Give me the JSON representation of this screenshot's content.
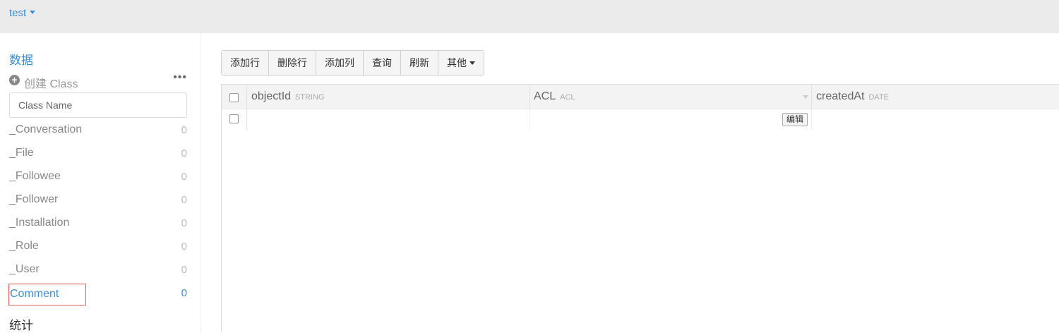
{
  "header": {
    "app_name": "test"
  },
  "sidebar": {
    "data_section": "数据",
    "create_class_label": "创建 Class",
    "class_name_placeholder": "Class Name",
    "classes": [
      {
        "name": "_Conversation",
        "count": "0"
      },
      {
        "name": "_File",
        "count": "0"
      },
      {
        "name": "_Followee",
        "count": "0"
      },
      {
        "name": "_Follower",
        "count": "0"
      },
      {
        "name": "_Installation",
        "count": "0"
      },
      {
        "name": "_Role",
        "count": "0"
      },
      {
        "name": "_User",
        "count": "0"
      },
      {
        "name": "Comment",
        "count": "0"
      }
    ],
    "active_class": "Comment",
    "stats_section": "统计"
  },
  "toolbar": {
    "add_row": "添加行",
    "delete_row": "删除行",
    "add_column": "添加列",
    "query": "查询",
    "refresh": "刷新",
    "other": "其他"
  },
  "grid": {
    "columns": [
      {
        "name": "objectId",
        "type": "STRING"
      },
      {
        "name": "ACL",
        "type": "ACL"
      },
      {
        "name": "createdAt",
        "type": "DATE"
      }
    ],
    "rows": [
      {
        "objectId": "",
        "acl_edit_label": "编辑",
        "createdAt": ""
      }
    ]
  },
  "colors": {
    "accent": "#3a8fd9",
    "highlight_border": "#e05a5a",
    "topbar": "#ebebeb"
  }
}
